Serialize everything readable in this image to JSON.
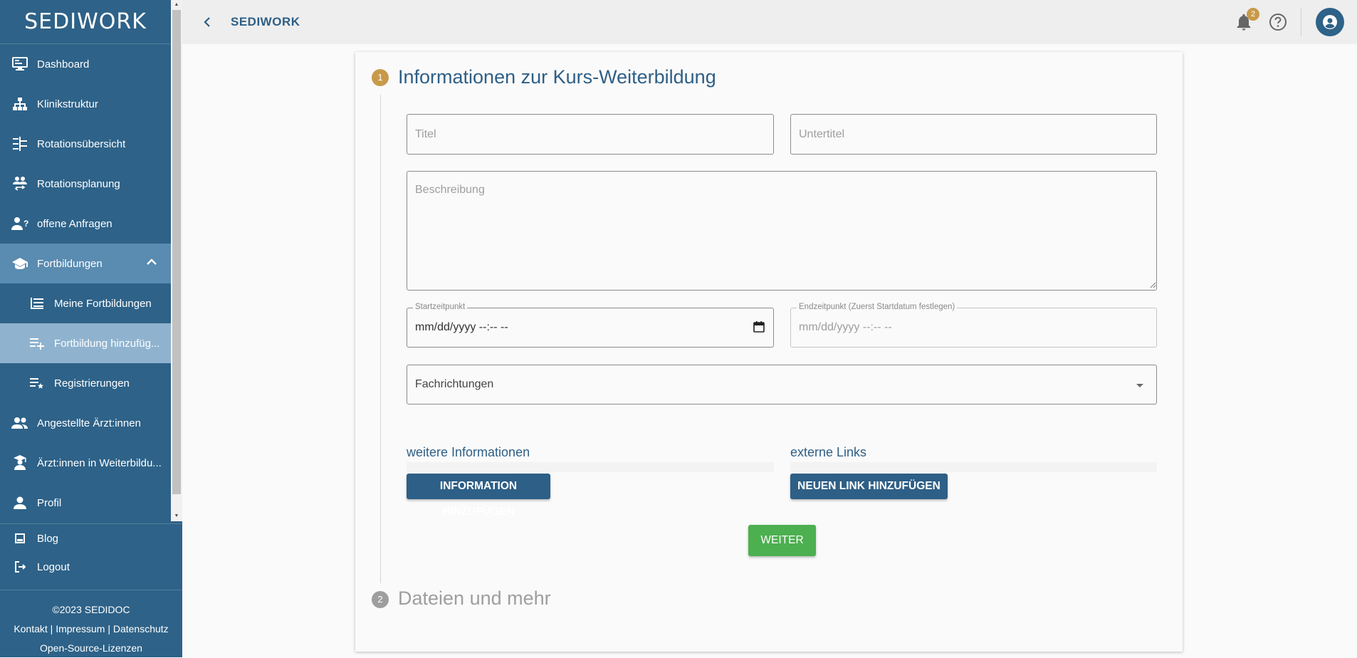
{
  "sidebar": {
    "logo": "SEDIWORK",
    "items": [
      {
        "label": "Dashboard"
      },
      {
        "label": "Klinikstruktur"
      },
      {
        "label": "Rotationsübersicht"
      },
      {
        "label": "Rotationsplanung"
      },
      {
        "label": "offene Anfragen"
      },
      {
        "label": "Fortbildungen"
      },
      {
        "label": "Meine Fortbildungen"
      },
      {
        "label": "Fortbildung hinzufüg..."
      },
      {
        "label": "Registrierungen"
      },
      {
        "label": "Angestellte Ärzt:innen"
      },
      {
        "label": "Ärzt:innen in Weiterbildu..."
      },
      {
        "label": "Profil"
      }
    ],
    "bottom": [
      {
        "label": "Blog"
      },
      {
        "label": "Logout"
      }
    ],
    "footer": {
      "copyright": "©2023 SEDIDOC",
      "links": "Kontakt | Impressum | Datenschutz",
      "oss": "Open-Source-Lizenzen"
    }
  },
  "header": {
    "title": "SEDIWORK",
    "notification_count": "2"
  },
  "form": {
    "step1": {
      "number": "1",
      "title": "Informationen zur Kurs-Weiterbildung"
    },
    "step2": {
      "number": "2",
      "title": "Dateien und mehr"
    },
    "title_placeholder": "Titel",
    "subtitle_placeholder": "Untertitel",
    "description_placeholder": "Beschreibung",
    "start_label": "Startzeitpunkt",
    "start_value": "mm/dd/yyyy --:-- --",
    "end_label": "Endzeitpunkt (Zuerst Startdatum festlegen)",
    "end_value": "mm/dd/yyyy --:-- --",
    "specialties_label": "Fachrichtungen",
    "more_info_label": "weitere Informationen",
    "external_links_label": "externe Links",
    "add_info_button": "INFORMATION HINZUFÜGEN",
    "add_link_button": "NEUEN LINK HINZUFÜGEN",
    "next_button": "WEITER"
  },
  "colors": {
    "sidebar": "#2e6288",
    "accent": "#c89a4a",
    "primary_button": "#2e5f86",
    "next_button": "#4caf50"
  }
}
